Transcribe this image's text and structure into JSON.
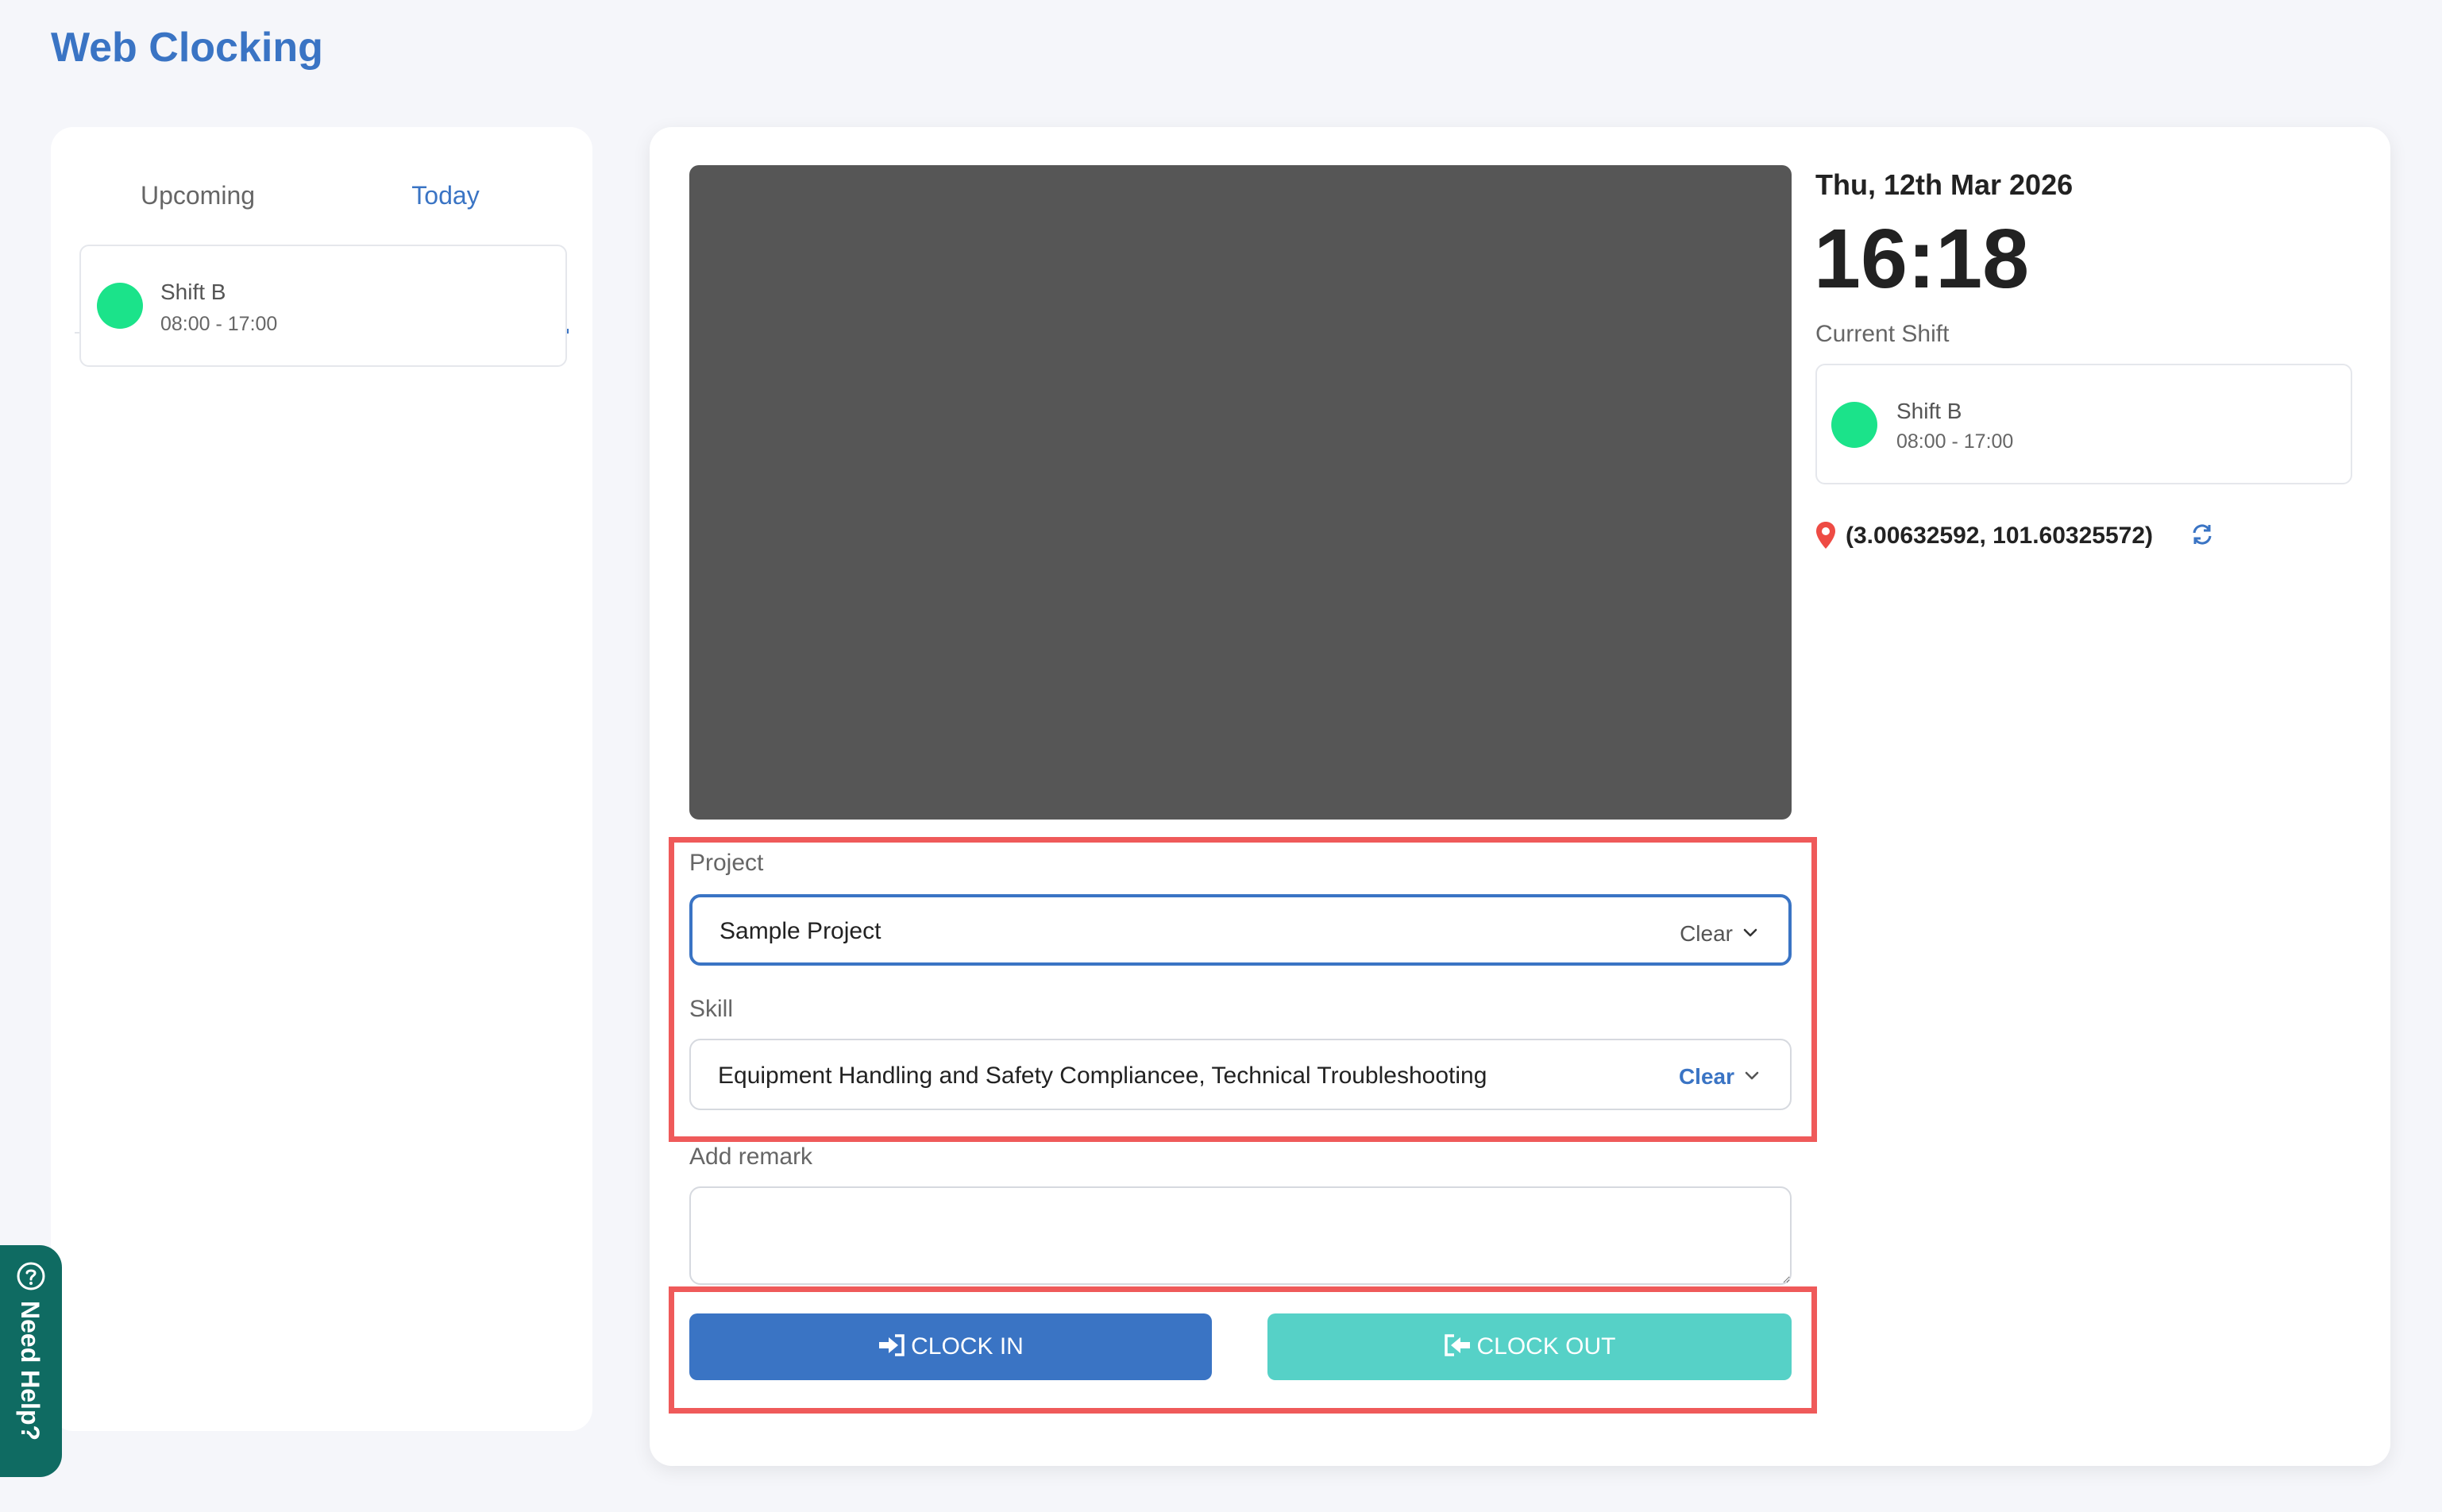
{
  "app": {
    "title": "Web Clocking"
  },
  "tabs": [
    {
      "label": "Upcoming"
    },
    {
      "label": "Today"
    }
  ],
  "active_tab": "Today",
  "shift_list": [
    {
      "name": "Shift B",
      "time": "08:00 - 17:00",
      "status_color": "#1be38a"
    }
  ],
  "clock": {
    "date": "Thu, 12th Mar 2026",
    "time": "16:18",
    "current_shift_label": "Current Shift",
    "current_shift": {
      "name": "Shift B",
      "time": "08:00 - 17:00"
    },
    "location": "(3.00632592, 101.60325572)"
  },
  "form": {
    "project": {
      "label": "Project",
      "value": "Sample Project",
      "clear_label": "Clear"
    },
    "skill": {
      "label": "Skill",
      "value": "Equipment Handling and Safety Compliancee, Technical Troubleshooting",
      "clear_label": "Clear"
    },
    "remark": {
      "label": "Add remark",
      "value": ""
    }
  },
  "buttons": {
    "clock_in": "CLOCK IN",
    "clock_out": "CLOCK OUT"
  },
  "help": {
    "label": "Need Help?"
  },
  "colors": {
    "accent": "#3a74c4",
    "clock_out": "#56d1c7",
    "highlight": "#ef5a5a",
    "shift_status": "#1be38a",
    "help_bg": "#0f6b62"
  },
  "icons": [
    "sign-in-icon",
    "sign-out-icon",
    "map-pin-icon",
    "refresh-icon",
    "chevron-down-icon",
    "help-circle-icon"
  ]
}
